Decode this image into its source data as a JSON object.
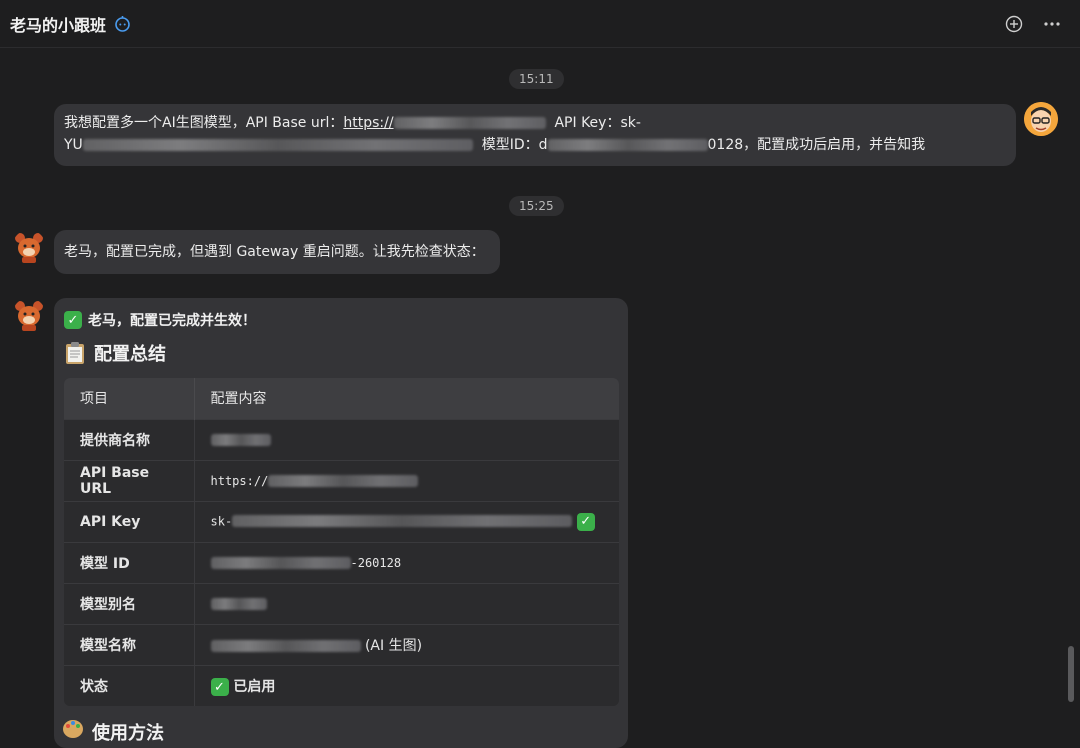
{
  "header": {
    "title": "老马的小跟班",
    "bot_icon": "bot-icon",
    "actions": [
      "add-icon",
      "more-icon"
    ]
  },
  "timestamps": [
    "15:11",
    "15:25"
  ],
  "user_message": {
    "line1_prefix": "我想配置多一个AI生图模型，API Base url：",
    "line1_link_prefix": "https://",
    "line1_after": "API Key：sk-",
    "line2_prefix": "YU",
    "line2_mid": "模型ID：d",
    "line2_suffix": "0128，配置成功后启用，并告知我"
  },
  "bot_message_1": {
    "text": "老马，配置已完成，但遇到 Gateway 重启问题。让我先检查状态："
  },
  "bot_message_2": {
    "headline": "老马，配置已完成并生效！",
    "summary_title": "配置总结",
    "table": {
      "headers": [
        "项目",
        "配置内容"
      ],
      "rows": [
        {
          "key": "提供商名称",
          "prefix": "",
          "suffix": ""
        },
        {
          "key": "API Base URL",
          "prefix": "https://",
          "suffix": ""
        },
        {
          "key": "API Key",
          "prefix": "sk-",
          "suffix": ""
        },
        {
          "key": "模型 ID",
          "prefix": "",
          "suffix": "-260128"
        },
        {
          "key": "模型别名",
          "prefix": "",
          "suffix": ""
        },
        {
          "key": "模型名称",
          "prefix": "",
          "suffix": " (AI 生图)"
        },
        {
          "key": "状态",
          "prefix": "",
          "suffix": "已启用"
        }
      ]
    },
    "usage_title": "使用方法"
  },
  "colors": {
    "background": "#1e1e1f",
    "bubble": "#353538",
    "check_green": "#3bb04a"
  }
}
